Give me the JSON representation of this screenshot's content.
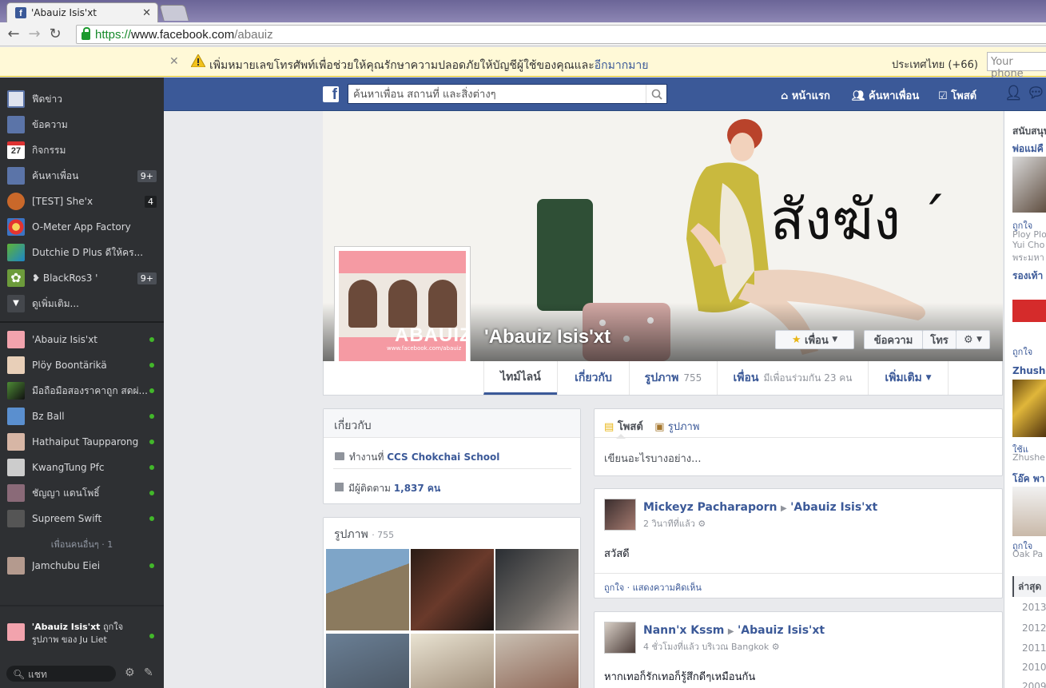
{
  "browser": {
    "tab_title": "'Abauiz Isis'xt",
    "url_scheme": "https://",
    "url_host": "www.facebook.com",
    "url_path": "/abauiz"
  },
  "notice": {
    "message": "เพิ่มหมายเลขโทรศัพท์เพื่อช่วยให้คุณรักษาความปลอดภัยให้บัญชีผู้ใช้ของคุณและ",
    "more_link": "อีกมากมาย",
    "country": "ประเทศไทย (+66)",
    "phone_placeholder": "Your phone"
  },
  "sidebar": {
    "nav": [
      {
        "label": "ฟีดข่าว",
        "icon": "news-feed-icon",
        "count": ""
      },
      {
        "label": "ข้อความ",
        "icon": "messages-icon",
        "count": ""
      },
      {
        "label": "กิจกรรม",
        "icon": "events-calendar-icon",
        "count": "",
        "icon_text": "27"
      },
      {
        "label": "ค้นหาเพื่อน",
        "icon": "find-friends-icon",
        "count": "9+"
      },
      {
        "label": "[TEST] She'x",
        "icon": "basketball-icon",
        "count": "4"
      },
      {
        "label": "O-Meter App Factory",
        "icon": "o-meter-app-icon",
        "count": ""
      },
      {
        "label": "Dutchie D Plus ดีให้คร...",
        "icon": "dutchie-app-icon",
        "count": ""
      },
      {
        "label": "❥ BlackRos3 '",
        "icon": "flower-icon",
        "count": "9+"
      },
      {
        "label": "ดูเพิ่มเติม...",
        "icon": "see-more-icon",
        "count": ""
      }
    ],
    "friends": [
      {
        "name": "'Abauiz Isis'xt"
      },
      {
        "name": "Plöy Boontärikä"
      },
      {
        "name": "มือถือมือสองราคาถูก สดผ่..."
      },
      {
        "name": "Bz Ball"
      },
      {
        "name": "Hathaiput Taupparong"
      },
      {
        "name": "KwangTung Pfc"
      },
      {
        "name": "ชัญญา แดนโพธิ์"
      },
      {
        "name": "Supreem Swift"
      }
    ],
    "other_friends_label": "เพื่อนคนอื่นๆ · 1",
    "other_friends": [
      {
        "name": "Jamchubu Eiei"
      }
    ],
    "ticker_name": "'Abauiz Isis'xt",
    "ticker_rest": " ถูกใจ รูปภาพ ของ Ju Liet",
    "chat_placeholder": "แชท"
  },
  "fbbar": {
    "search_placeholder": "ค้นหาเพื่อน สถานที่ และสิ่งต่างๆ",
    "home": "หน้าแรก",
    "find_friends": "ค้นหาเพื่อน",
    "post": "โพสต์"
  },
  "profile": {
    "name": "'Abauiz Isis'xt",
    "cover_text": "สังฆัง ˊ",
    "profile_watermark": "ABAUIZ",
    "profile_watermark_url": "www.facebook.com/abauiz",
    "friend_button": "เพื่อน",
    "message_button": "ข้อความ",
    "call_button": "โทร",
    "tabs": {
      "timeline": "ไทม์ไลน์",
      "about": "เกี่ยวกับ",
      "photos": "รูปภาพ",
      "photos_count": "755",
      "friends": "เพื่อน",
      "friends_mutual": "มีเพื่อนร่วมกัน 23 คน",
      "more": "เพิ่มเติม"
    }
  },
  "about": {
    "header": "เกี่ยวกับ",
    "work_prefix": "ทำงานที่ ",
    "work_place": "CCS Chokchai School",
    "followers_prefix": "มีผู้ติดตาม ",
    "followers_value": "1,837 คน"
  },
  "photos_card": {
    "header": "รูปภาพ",
    "count": "· 755"
  },
  "composer": {
    "post_tab": "โพสต์",
    "photo_tab": "รูปภาพ",
    "placeholder": "เขียนอะไรบางอย่าง..."
  },
  "posts": [
    {
      "author": "Mickeyz Pacharaporn",
      "target": "'Abauiz Isis'xt",
      "time": "2 วินาทีที่แล้ว",
      "text": "สวัสดี",
      "actions": "ถูกใจ · แสดงความคิดเห็น"
    },
    {
      "author": "Nann'x Kssm",
      "target": "'Abauiz Isis'xt",
      "time": "4 ชั่วโมงที่แล้ว บริเวณ Bangkok",
      "text": "หากเทอก็รักเทอก็รู้สึกดีๆเหมือนกัน"
    }
  ],
  "right_column": {
    "sponsored": "สนับสนุน",
    "ad1_title": "พ่อแม่คื",
    "ad1_like": "ถูกใจ",
    "ad1_line1": "Ploy Plo",
    "ad1_line2": "Yui Cho",
    "ad1_line3": "พระมหา",
    "ad2_title": "รองเท้า",
    "ad2_like": "ถูกใจ",
    "ad3_title": "Zhushe",
    "ad3_like": "ใช้แ",
    "ad3_sub": "Zhushe",
    "ad4_title": "โอ๊ค พา",
    "ad4_like": "ถูกใจ",
    "ad4_sub": "Oak Pa",
    "latest": "ล่าสุด",
    "years": [
      "2013",
      "2012",
      "2011",
      "2010",
      "2009"
    ]
  },
  "colors": {
    "fb_blue": "#3b5998",
    "sidebar_bg": "#2e3033",
    "online_green": "#42b72a",
    "notice_bg": "#fff9d7"
  }
}
